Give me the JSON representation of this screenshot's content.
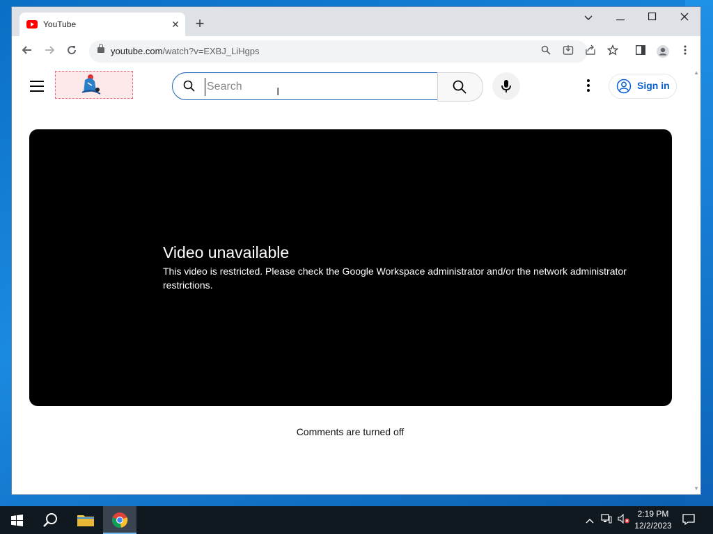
{
  "browser": {
    "tab_title": "YouTube",
    "tab_close": "✕",
    "new_tab": "+",
    "url_host": "youtube.com",
    "url_path": "/watch?v=EXBJ_LiHgps"
  },
  "youtube": {
    "search_placeholder": "Search",
    "sign_in_label": "Sign in",
    "error_title": "Video unavailable",
    "error_message": "This video is restricted. Please check the Google Workspace administrator and/or the network administrator restrictions.",
    "comments_status": "Comments are turned off"
  },
  "taskbar": {
    "time": "2:19 PM",
    "date": "12/2/2023"
  },
  "colors": {
    "youtube_red": "#ff0000",
    "link_blue": "#065fd4",
    "search_focus": "#1c62b9",
    "desktop_blue": "#0a6fc4"
  },
  "icons": [
    "youtube-favicon",
    "close-icon",
    "plus-icon",
    "back-icon",
    "forward-icon",
    "reload-icon",
    "lock-icon",
    "zoom-icon",
    "install-icon",
    "share-icon",
    "star-icon",
    "side-panel-icon",
    "profile-icon",
    "kebab-icon",
    "hamburger-icon",
    "search-icon",
    "mic-icon",
    "account-icon",
    "windows-icon",
    "folder-icon",
    "chrome-icon",
    "chevron-up-icon",
    "network-icon",
    "volume-muted-icon",
    "notification-icon"
  ]
}
